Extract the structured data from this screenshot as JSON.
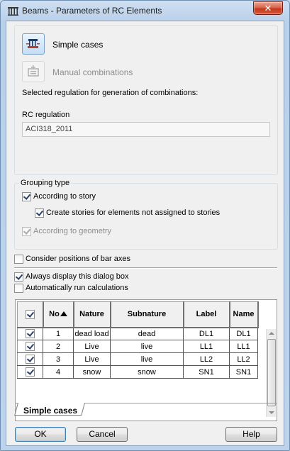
{
  "window": {
    "title": "Beams - Parameters of RC Elements",
    "close_glyph": "✕"
  },
  "top_section": {
    "simple_cases_label": "Simple cases",
    "manual_combinations_label": "Manual combinations",
    "selected_regulation_text": "Selected regulation for generation of combinations:",
    "rc_regulation_label": "RC regulation",
    "rc_regulation_value": "ACI318_2011"
  },
  "grouping": {
    "title": "Grouping type",
    "according_to_story": {
      "label": "According to story",
      "checked": true
    },
    "create_stories": {
      "label": "Create stories for elements not assigned to stories",
      "checked": true
    },
    "according_to_geometry": {
      "label": "According to geometry",
      "checked": true,
      "enabled": false
    }
  },
  "options": {
    "consider_positions": {
      "label": "Consider positions of bar axes",
      "checked": false
    },
    "always_display": {
      "label": "Always display this dialog box",
      "checked": true
    },
    "auto_run": {
      "label": "Automatically run calculations",
      "checked": false
    }
  },
  "grid": {
    "columns": [
      "No",
      "Nature",
      "Subnature",
      "Label",
      "Name"
    ],
    "sort_column": "No",
    "rows": [
      {
        "checked": true,
        "no": "1",
        "nature": "dead load",
        "subnature": "dead",
        "label": "DL1",
        "name": "DL1"
      },
      {
        "checked": true,
        "no": "2",
        "nature": "Live",
        "subnature": "live",
        "label": "LL1",
        "name": "LL1"
      },
      {
        "checked": true,
        "no": "3",
        "nature": "Live",
        "subnature": "live",
        "label": "LL2",
        "name": "LL2"
      },
      {
        "checked": true,
        "no": "4",
        "nature": "snow",
        "subnature": "snow",
        "label": "SN1",
        "name": "SN1"
      }
    ],
    "tab_label": "Simple cases"
  },
  "buttons": {
    "ok": "OK",
    "cancel": "Cancel",
    "help": "Help"
  },
  "colors": {
    "window_frame": "#bdd3ec",
    "close_button": "#c9452a",
    "dialog_bg": "#f0f0f0"
  }
}
